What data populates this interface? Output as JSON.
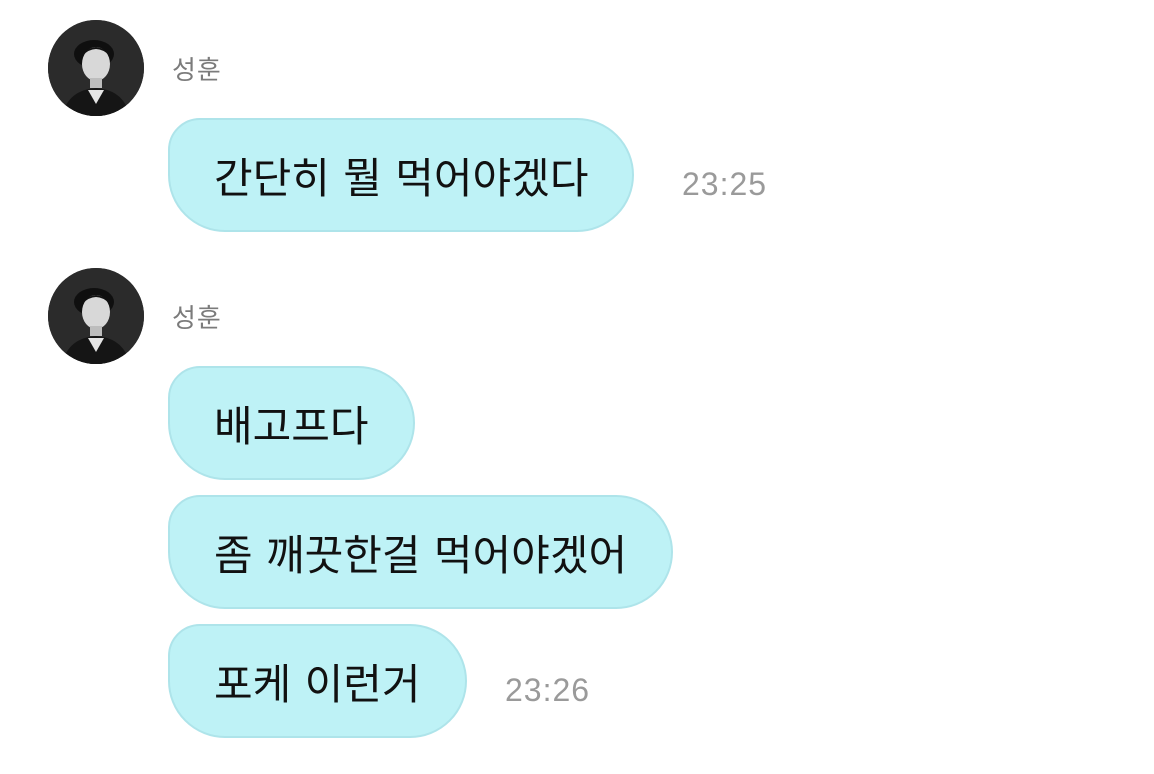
{
  "chat": {
    "groups": [
      {
        "sender": "성훈",
        "messages": [
          {
            "text": "간단히 뭘 먹어야겠다",
            "time": "23:25"
          }
        ]
      },
      {
        "sender": "성훈",
        "messages": [
          {
            "text": "배고프다",
            "time": ""
          },
          {
            "text": "좀 깨끗한걸 먹어야겠어",
            "time": ""
          },
          {
            "text": "포케 이런거",
            "time": "23:26"
          }
        ]
      }
    ]
  },
  "colors": {
    "bubble": "#bef2f6",
    "bubble_border": "#aee4ea",
    "sender_text": "#7b7b7b",
    "time_text": "#9a9a9a"
  }
}
